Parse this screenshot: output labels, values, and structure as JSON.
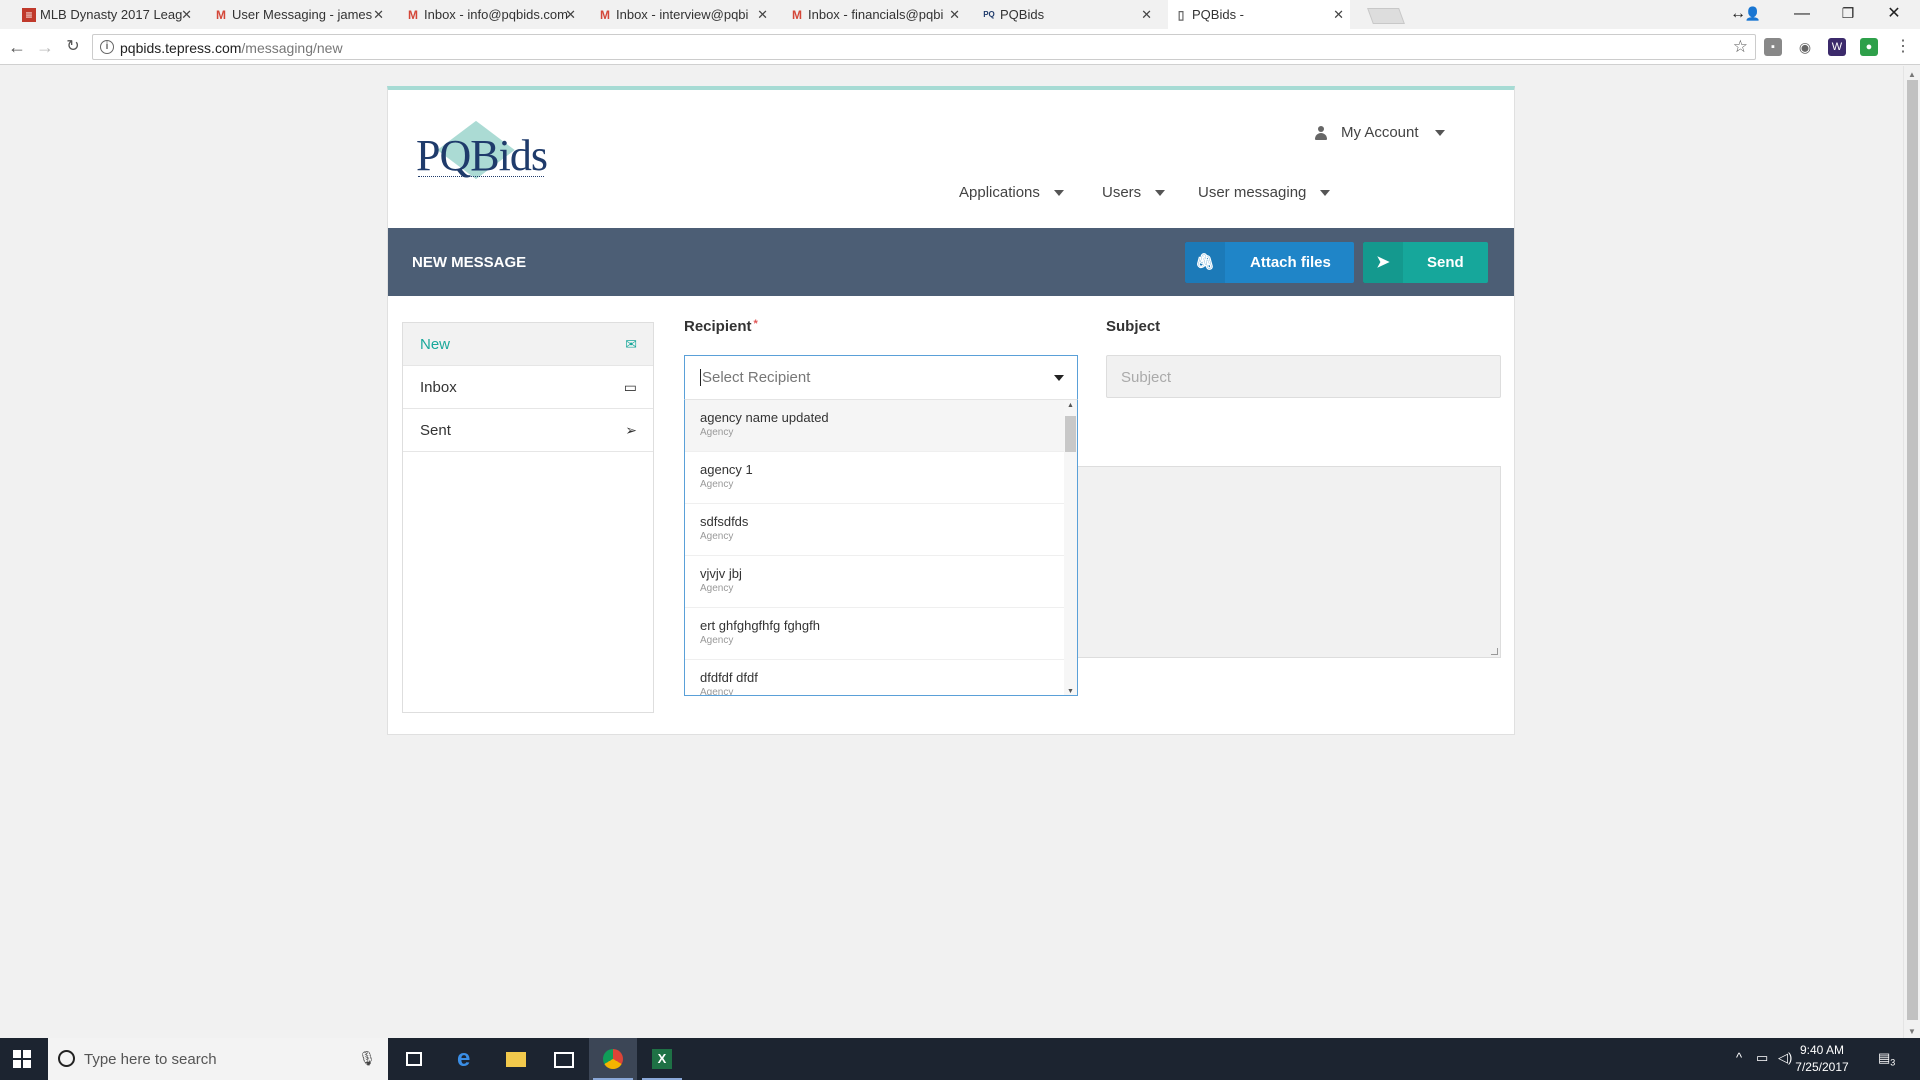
{
  "browser": {
    "tabs": [
      {
        "title": "MLB Dynasty 2017 Leag",
        "icon": "spreadsheet-icon"
      },
      {
        "title": "User Messaging - james",
        "icon": "gmail-icon"
      },
      {
        "title": "Inbox - info@pqbids.com",
        "icon": "gmail-icon"
      },
      {
        "title": "Inbox - interview@pqbi",
        "icon": "gmail-icon"
      },
      {
        "title": "Inbox - financials@pqbi",
        "icon": "gmail-icon"
      },
      {
        "title": "PQBids",
        "icon": "pqbids-favicon"
      },
      {
        "title": "PQBids -",
        "icon": "page-icon"
      }
    ],
    "url_host": "pqbids.tepress.com",
    "url_path": "/messaging/new"
  },
  "header": {
    "logo_text": "PQBids",
    "account_label": "My Account",
    "nav": [
      {
        "label": "Applications"
      },
      {
        "label": "Users"
      },
      {
        "label": "User messaging"
      }
    ]
  },
  "toolbar": {
    "title": "NEW MESSAGE",
    "attach_label": "Attach files",
    "send_label": "Send"
  },
  "sidenav": {
    "items": [
      {
        "label": "New",
        "icon": "envelope-icon",
        "active": true
      },
      {
        "label": "Inbox",
        "icon": "inbox-icon",
        "active": false
      },
      {
        "label": "Sent",
        "icon": "paper-plane-icon",
        "active": false
      }
    ]
  },
  "form": {
    "recipient_label": "Recipient",
    "recipient_required": "*",
    "recipient_placeholder": "Select Recipient",
    "subject_label": "Subject",
    "subject_placeholder": "Subject"
  },
  "dropdown": {
    "options": [
      {
        "name": "agency name updated",
        "type": "Agency"
      },
      {
        "name": "agency 1",
        "type": "Agency"
      },
      {
        "name": "sdfsdfds",
        "type": "Agency"
      },
      {
        "name": "vjvjv jbj",
        "type": "Agency"
      },
      {
        "name": "ert ghfghgfhfg fghgfh",
        "type": "Agency"
      },
      {
        "name": "dfdfdf dfdf",
        "type": "Agency"
      }
    ]
  },
  "taskbar": {
    "search_placeholder": "Type here to search",
    "time": "9:40 AM",
    "date": "7/25/2017",
    "notification_count": "3"
  },
  "colors": {
    "accent_teal": "#16a79b",
    "attach_blue": "#1f85c8",
    "header_band": "#4c5e75"
  }
}
